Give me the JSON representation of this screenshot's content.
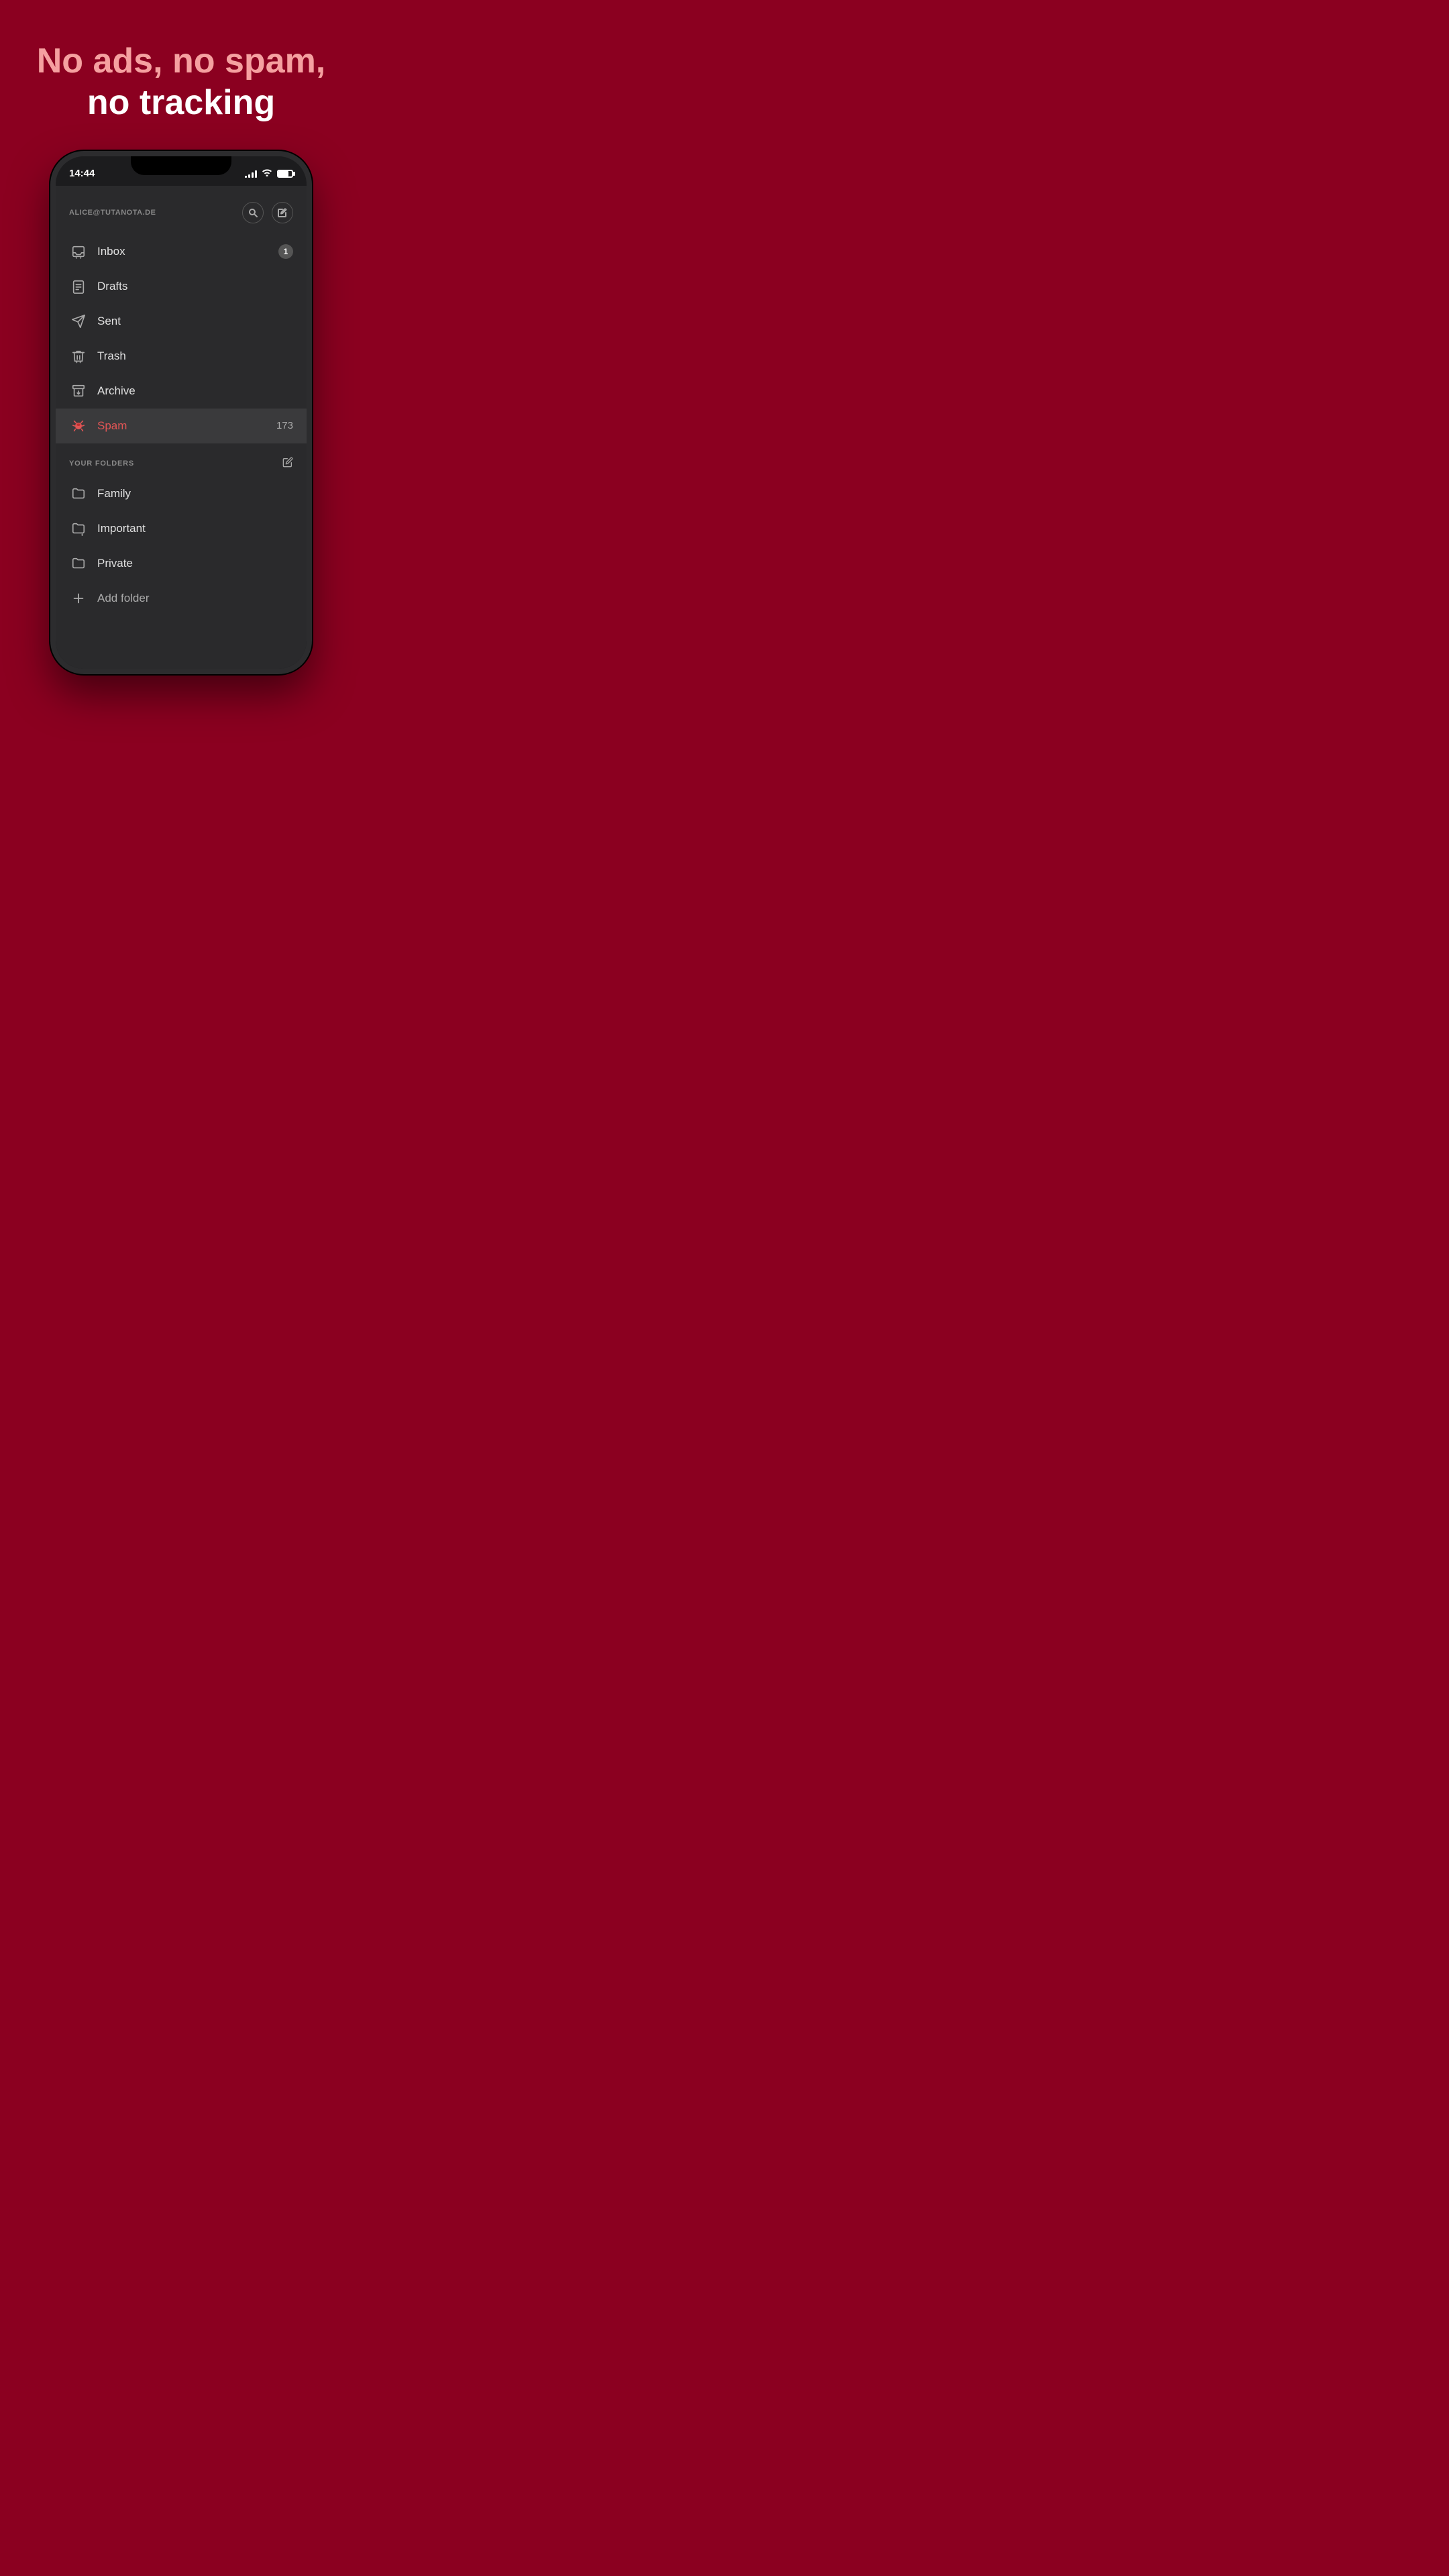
{
  "tagline": {
    "line1": "No ads, no spam,",
    "line2": "no tracking"
  },
  "status_bar": {
    "time": "14:44"
  },
  "app": {
    "account": "ALICE@TUTANOTA.DE",
    "menu_items": [
      {
        "id": "inbox",
        "label": "Inbox",
        "badge": "1",
        "active": false
      },
      {
        "id": "drafts",
        "label": "Drafts",
        "badge": null,
        "active": false
      },
      {
        "id": "sent",
        "label": "Sent",
        "badge": null,
        "active": false
      },
      {
        "id": "trash",
        "label": "Trash",
        "badge": null,
        "active": false
      },
      {
        "id": "archive",
        "label": "Archive",
        "badge": null,
        "active": false
      },
      {
        "id": "spam",
        "label": "Spam",
        "badge": "173",
        "active": true
      }
    ],
    "folders_section_title": "YOUR FOLDERS",
    "folders_edit_label": "✏",
    "folders": [
      {
        "id": "family",
        "label": "Family"
      },
      {
        "id": "important",
        "label": "Important"
      },
      {
        "id": "private",
        "label": "Private"
      }
    ],
    "add_folder_label": "Add folder"
  }
}
